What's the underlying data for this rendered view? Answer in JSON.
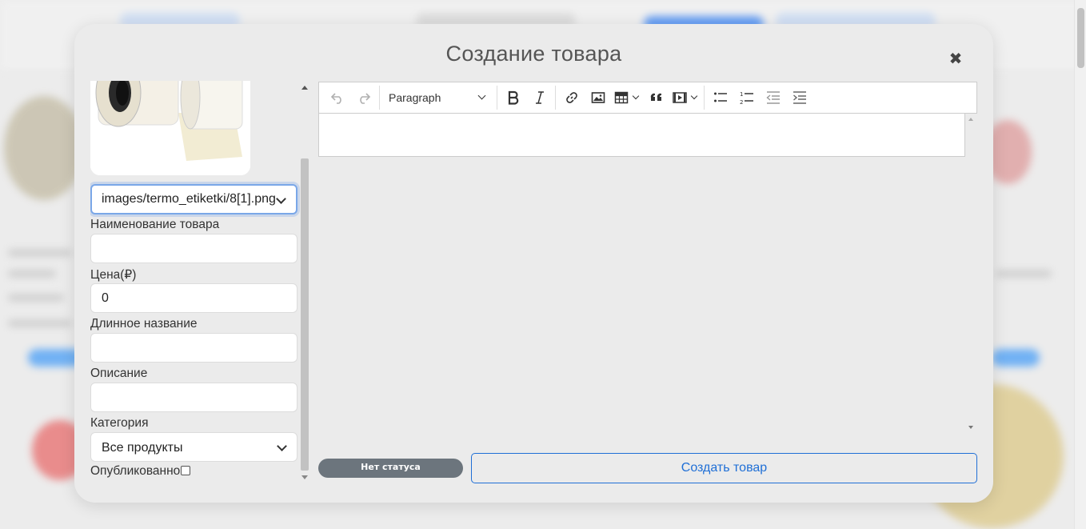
{
  "modal": {
    "title": "Создание товара",
    "close_icon": "close-icon"
  },
  "form": {
    "image_select_value": "images/termo_etiketki/8[1].png",
    "name_label": "Наименование товара",
    "name_value": "",
    "price_label": "Цена(₽)",
    "price_value": "0",
    "long_name_label": "Длинное название",
    "long_name_value": "",
    "description_label": "Описание",
    "description_value": "",
    "category_label": "Категория",
    "category_value": "Все продукты",
    "published_label": "Опубликованно",
    "published_checked": false
  },
  "editor": {
    "block_format": "Paragraph",
    "toolbar_icons": [
      "undo-icon",
      "redo-icon",
      "bold-icon",
      "italic-icon",
      "link-icon",
      "image-icon",
      "table-icon",
      "blockquote-icon",
      "media-icon",
      "bulleted-list-icon",
      "numbered-list-icon",
      "outdent-icon",
      "indent-icon"
    ],
    "content": ""
  },
  "footer": {
    "status_label": "Нет статуса",
    "create_button_label": "Создать товар"
  },
  "colors": {
    "primary": "#1f6fd6",
    "status_badge": "#6c757d",
    "modal_bg": "#ebebeb"
  }
}
